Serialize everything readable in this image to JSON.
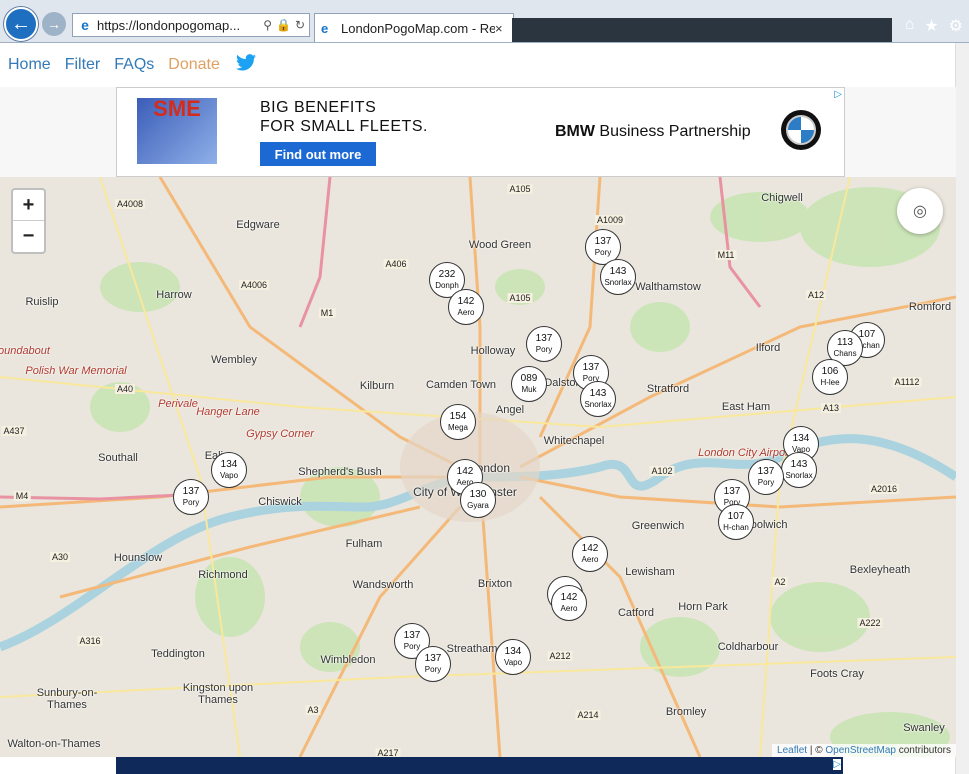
{
  "browser": {
    "url": "https://londonpogomap...",
    "tab_title": "LondonPogoMap.com - Re...",
    "back_icon": "arrow-left-icon",
    "forward_icon": "arrow-right-icon"
  },
  "nav": {
    "home": "Home",
    "filter": "Filter",
    "faqs": "FAQs",
    "donate": "Donate",
    "twitter_icon": "twitter-icon"
  },
  "ad": {
    "logo_text": "SME",
    "headline_line1": "BIG BENEFITS",
    "headline_line2": "FOR SMALL FLEETS.",
    "cta": "Find out more",
    "brand_bold": "BMW",
    "brand_rest": " Business Partnership",
    "adchoice": "▷"
  },
  "map": {
    "zoom_in": "+",
    "zoom_out": "−",
    "attribution_leaflet": "Leaflet",
    "attribution_sep": " | © ",
    "attribution_osm": "OpenStreetMap",
    "attribution_rest": " contributors",
    "places": [
      {
        "name": "Chigwell"
      },
      {
        "name": "Edgware"
      },
      {
        "name": "Wood Green"
      },
      {
        "name": "Harrow"
      },
      {
        "name": "Ruislip"
      },
      {
        "name": "Romford"
      },
      {
        "name": "Holloway"
      },
      {
        "name": "Ilford"
      },
      {
        "name": "Wembley"
      },
      {
        "name": "Kilburn"
      },
      {
        "name": "Camden Town"
      },
      {
        "name": "Dalston"
      },
      {
        "name": "Stratford"
      },
      {
        "name": "Angel"
      },
      {
        "name": "East Ham"
      },
      {
        "name": "Whitechapel"
      },
      {
        "name": "Southall"
      },
      {
        "name": "Ealing"
      },
      {
        "name": "Shepherd's Bush"
      },
      {
        "name": "London"
      },
      {
        "name": "City of Westminster"
      },
      {
        "name": "Chiswick"
      },
      {
        "name": "Greenwich"
      },
      {
        "name": "Woolwich"
      },
      {
        "name": "Hounslow"
      },
      {
        "name": "Fulham"
      },
      {
        "name": "Lewisham"
      },
      {
        "name": "Bexleyheath"
      },
      {
        "name": "Richmond"
      },
      {
        "name": "Wandsworth"
      },
      {
        "name": "Brixton"
      },
      {
        "name": "Catford"
      },
      {
        "name": "Horn Park"
      },
      {
        "name": "Teddington"
      },
      {
        "name": "Wimbledon"
      },
      {
        "name": "Streatham"
      },
      {
        "name": "Coldharbour"
      },
      {
        "name": "Foots Cray"
      },
      {
        "name": "Sunbury-on-Thames"
      },
      {
        "name": "Kingston upon Thames"
      },
      {
        "name": "Bromley"
      },
      {
        "name": "Swanley"
      },
      {
        "name": "Walton-on-Thames"
      },
      {
        "name": "Walthamstow"
      },
      {
        "name": "Polish War Memorial"
      },
      {
        "name": "Perivale"
      },
      {
        "name": "Hanger Lane"
      },
      {
        "name": "Gypsy Corner"
      },
      {
        "name": "London City Airport"
      },
      {
        "name": "Roundabout"
      }
    ],
    "roads": [
      "A4008",
      "A105",
      "A1009",
      "A406",
      "M11",
      "A4006",
      "A105",
      "A12",
      "M1",
      "A1112",
      "A13",
      "A40",
      "A437",
      "A102",
      "A2016",
      "M4",
      "A30",
      "A2",
      "A222",
      "A316",
      "A212",
      "A3",
      "A214",
      "A217",
      "M4"
    ],
    "markers": [
      {
        "num": "137",
        "name": "Pory"
      },
      {
        "num": "143",
        "name": "Snorlax"
      },
      {
        "num": "232",
        "name": "Donph"
      },
      {
        "num": "142",
        "name": "Aero"
      },
      {
        "num": "137",
        "name": "Pory"
      },
      {
        "num": "107",
        "name": "H-chan"
      },
      {
        "num": "113",
        "name": "Chans"
      },
      {
        "num": "106",
        "name": "H-lee"
      },
      {
        "num": "137",
        "name": "Pory"
      },
      {
        "num": "089",
        "name": "Muk"
      },
      {
        "num": "143",
        "name": "Snorlax"
      },
      {
        "num": "154",
        "name": "Mega"
      },
      {
        "num": "134",
        "name": "Vapo"
      },
      {
        "num": "143",
        "name": "Snorlax"
      },
      {
        "num": "137",
        "name": "Pory"
      },
      {
        "num": "134",
        "name": "Vapo"
      },
      {
        "num": "142",
        "name": "Aero"
      },
      {
        "num": "130",
        "name": "Gyara"
      },
      {
        "num": "137",
        "name": "Pory"
      },
      {
        "num": "137",
        "name": "Pory"
      },
      {
        "num": "107",
        "name": "H-chan"
      },
      {
        "num": "142",
        "name": "Aero"
      },
      {
        "num": "232",
        "name": ""
      },
      {
        "num": "142",
        "name": "Aero"
      },
      {
        "num": "137",
        "name": "Pory"
      },
      {
        "num": "137",
        "name": "Pory"
      },
      {
        "num": "134",
        "name": "Vapo"
      }
    ]
  }
}
